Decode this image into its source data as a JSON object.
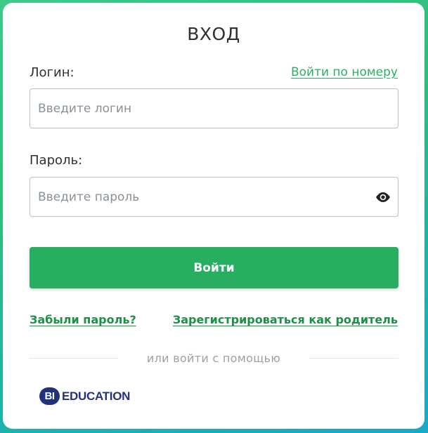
{
  "form": {
    "title": "ВХОД",
    "login": {
      "label": "Логин:",
      "alt_link": "Войти по номеру",
      "placeholder": "Введите логин",
      "value": ""
    },
    "password": {
      "label": "Пароль:",
      "placeholder": "Введите пароль",
      "value": "",
      "toggle_icon": "eye-icon"
    },
    "submit_label": "Войти",
    "forgot_link": "Забыли пароль?",
    "register_link": "Зарегистрироваться как родитель",
    "divider_text": "или войти с помощью"
  },
  "providers": [
    {
      "badge": "BI",
      "name": "EDUCATION"
    }
  ],
  "colors": {
    "accent": "#27ae60",
    "link_dark": "#1e8f47",
    "brand": "#22317e"
  }
}
